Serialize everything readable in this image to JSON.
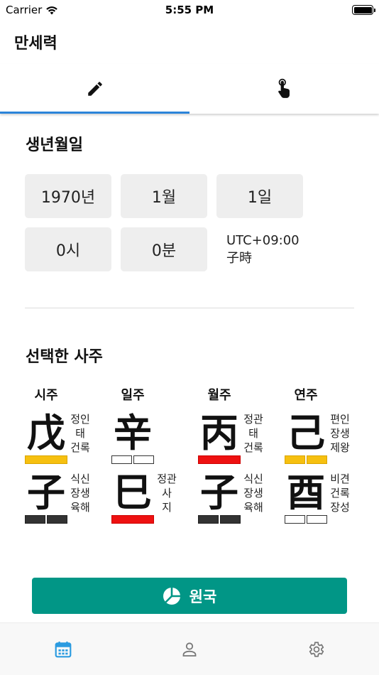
{
  "status_bar": {
    "carrier": "Carrier",
    "time": "5:55 PM"
  },
  "app_bar": {
    "title": "만세력"
  },
  "tabs": [
    {
      "icon": "pencil-icon",
      "active": true
    },
    {
      "icon": "touch-icon",
      "active": false
    }
  ],
  "birth": {
    "title": "생년월일",
    "year": "1970년",
    "month": "1월",
    "day": "1일",
    "hour": "0시",
    "minute": "0분",
    "timezone": "UTC+09:00",
    "hour_branch": "子時"
  },
  "saju": {
    "title": "선택한 사주",
    "pillars": [
      {
        "label": "시주",
        "stem": {
          "char": "戊",
          "notes": [
            "정인",
            "태",
            "건록"
          ],
          "bar": "yellow"
        },
        "branch": {
          "char": "子",
          "notes": [
            "식신",
            "장생",
            "육해"
          ],
          "bar": "dark"
        }
      },
      {
        "label": "일주",
        "stem": {
          "char": "辛",
          "notes": [],
          "bar": "white"
        },
        "branch": {
          "char": "巳",
          "notes": [
            "정관",
            "사",
            "지"
          ],
          "bar": "red"
        }
      },
      {
        "label": "월주",
        "stem": {
          "char": "丙",
          "notes": [
            "정관",
            "태",
            "건록"
          ],
          "bar": "red"
        },
        "branch": {
          "char": "子",
          "notes": [
            "식신",
            "장생",
            "육해"
          ],
          "bar": "dark"
        }
      },
      {
        "label": "연주",
        "stem": {
          "char": "己",
          "notes": [
            "편인",
            "장생",
            "제왕"
          ],
          "bar": "yellow"
        },
        "branch": {
          "char": "酉",
          "notes": [
            "비견",
            "건록",
            "장성"
          ],
          "bar": "white"
        }
      }
    ]
  },
  "origin_button": {
    "label": "원국",
    "icon": "pie-chart-icon"
  },
  "bottom_nav": [
    {
      "icon": "calendar-icon",
      "active": true
    },
    {
      "icon": "person-icon",
      "active": false
    },
    {
      "icon": "gear-icon",
      "active": false
    }
  ],
  "colors": {
    "accent": "#2b84d9",
    "button": "#019686",
    "bar_yellow": "#f6c010",
    "bar_red": "#ee1111",
    "bar_dark": "#333333"
  }
}
